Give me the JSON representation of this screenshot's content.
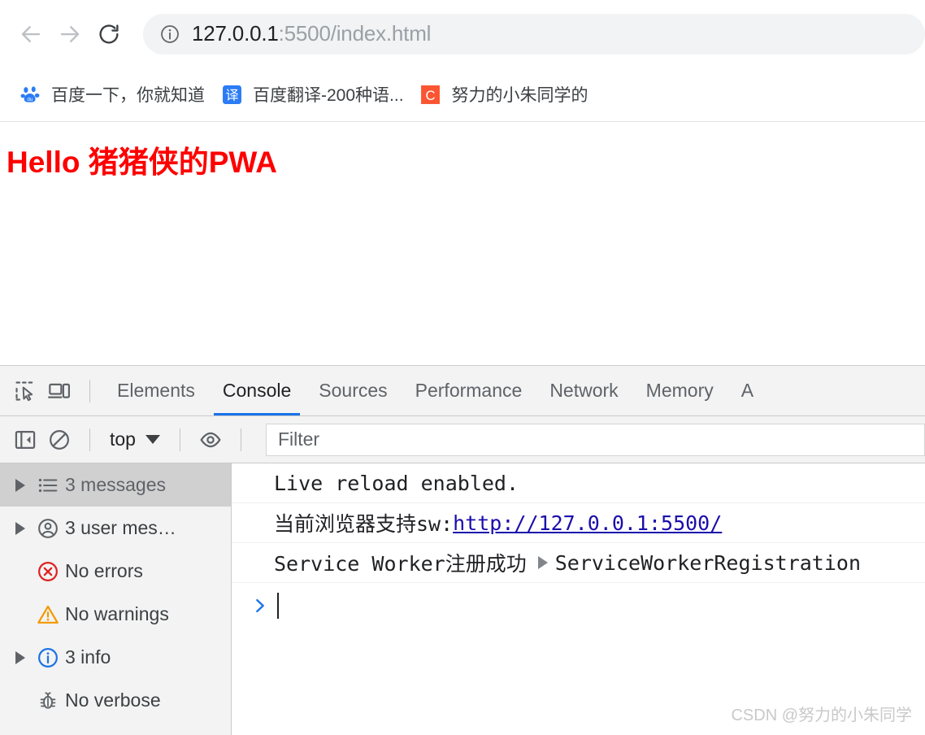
{
  "browser": {
    "nav": {
      "back_icon": "arrow-left-icon",
      "forward_icon": "arrow-right-icon",
      "reload_icon": "reload-icon"
    },
    "omnibox": {
      "info_icon": "info-circle-icon",
      "url_host": "127.0.0.1",
      "url_rest": ":5500/index.html",
      "full_url": "127.0.0.1:5500/index.html"
    },
    "bookmarks": [
      {
        "label": "百度一下，你就知道",
        "icon": "baidu-paw-icon"
      },
      {
        "label": "百度翻译-200种语...",
        "icon": "baidu-translate-icon"
      },
      {
        "label": "努力的小朱同学的",
        "icon": "csdn-icon"
      }
    ]
  },
  "page": {
    "heading": "Hello 猪猪侠的PWA",
    "heading_color": "#ff0000"
  },
  "devtools": {
    "inspect_icon": "inspect-element-icon",
    "device_icon": "device-toolbar-icon",
    "tabs": [
      {
        "label": "Elements",
        "active": false
      },
      {
        "label": "Console",
        "active": true
      },
      {
        "label": "Sources",
        "active": false
      },
      {
        "label": "Performance",
        "active": false
      },
      {
        "label": "Network",
        "active": false
      },
      {
        "label": "Memory",
        "active": false
      },
      {
        "label": "A",
        "active": false
      }
    ],
    "active_tab_underline_color": "#1a73e8",
    "console_toolbar": {
      "sidebar_toggle_icon": "show-console-sidebar-icon",
      "clear_icon": "clear-console-icon",
      "context": "top",
      "context_caret_icon": "chevron-down-icon",
      "eye_icon": "create-live-expression-icon",
      "filter_placeholder": "Filter"
    },
    "sidebar": [
      {
        "label": "3 messages",
        "icon": "list-icon",
        "expandable": true,
        "selected": true
      },
      {
        "label": "3 user mes…",
        "icon": "user-icon",
        "expandable": true,
        "selected": false
      },
      {
        "label": "No errors",
        "icon": "error-icon",
        "expandable": false,
        "selected": false
      },
      {
        "label": "No warnings",
        "icon": "warning-icon",
        "expandable": false,
        "selected": false
      },
      {
        "label": "3 info",
        "icon": "info-icon",
        "expandable": true,
        "selected": false
      },
      {
        "label": "No verbose",
        "icon": "bug-icon",
        "expandable": false,
        "selected": false
      }
    ],
    "messages": [
      {
        "text": "Live reload enabled.",
        "link": "",
        "suffix": "",
        "expandable_object": ""
      },
      {
        "text": "当前浏览器支持sw: ",
        "link": "http://127.0.0.1:5500/",
        "suffix": "",
        "expandable_object": ""
      },
      {
        "text": "Service Worker注册成功",
        "link": "",
        "suffix": "",
        "expandable_object": "ServiceWorkerRegistration"
      }
    ],
    "prompt": {
      "chevron_icon": "prompt-chevron-icon",
      "value": ""
    }
  },
  "watermark": "CSDN @努力的小朱同学"
}
